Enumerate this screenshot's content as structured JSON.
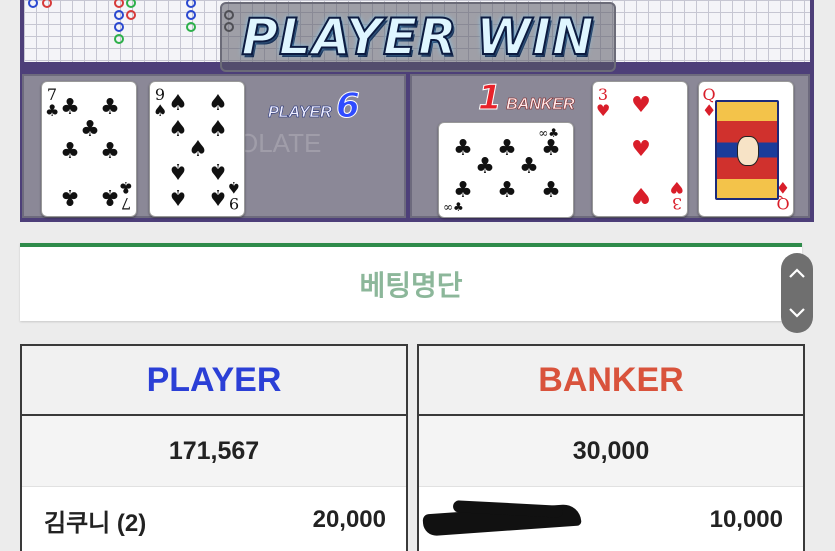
{
  "game": {
    "result_text": "PLAYER WIN",
    "watermark": "OLATE",
    "player": {
      "label": "PLAYER",
      "score": "6",
      "cards": [
        {
          "rank": "7",
          "suit": "♣",
          "color": "black"
        },
        {
          "rank": "9",
          "suit": "♠",
          "color": "black"
        }
      ]
    },
    "banker": {
      "label": "BANKER",
      "score": "1",
      "cards": [
        {
          "rank": "∞",
          "suit": "♣",
          "color": "black",
          "rotated": true
        },
        {
          "rank": "3",
          "suit": "♥",
          "color": "red"
        },
        {
          "rank": "Q",
          "suit": "♦",
          "color": "red"
        }
      ]
    }
  },
  "betting_list": {
    "title": "베팅명단",
    "scroll_up_icon": "chevron-up-icon",
    "scroll_down_icon": "chevron-down-icon",
    "player": {
      "header": "PLAYER",
      "total": "171,567",
      "rows": [
        {
          "name": "김쿠니 (2)",
          "amount": "20,000"
        }
      ]
    },
    "banker": {
      "header": "BANKER",
      "total": "30,000",
      "rows": [
        {
          "name": "",
          "amount": "10,000"
        }
      ]
    }
  },
  "colors": {
    "player_blue": "#2b3fd6",
    "banker_red": "#d9533c",
    "accent_green": "#2e8b4a"
  }
}
